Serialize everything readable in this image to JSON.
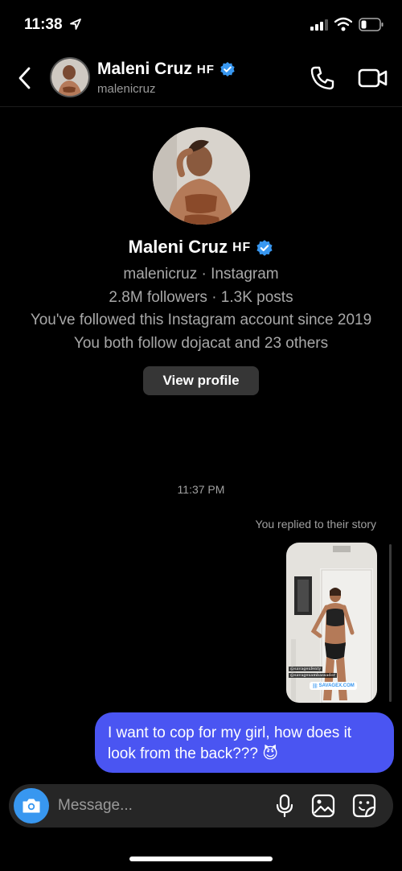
{
  "status_bar": {
    "time": "11:38"
  },
  "header": {
    "name": "Maleni Cruz",
    "name_tag": "HF",
    "username": "malenicruz"
  },
  "profile": {
    "name": "Maleni Cruz",
    "name_tag": "HF",
    "line1": "malenicruz · Instagram",
    "line2": "2.8M followers · 1.3K posts",
    "line3": "You've followed this Instagram account since 2019",
    "line4": "You both follow dojacat and 23 others",
    "view_profile_label": "View profile"
  },
  "thread": {
    "timestamp": "11:37 PM",
    "replied_note": "You replied to their story",
    "story_caption_1": "@savagexfenty",
    "story_caption_2": "@savagexambassador",
    "story_link": "SAVAGEX.COM",
    "message_text": "I want to cop for my girl, how does it look from the back??? 😈"
  },
  "composer": {
    "placeholder": "Message..."
  },
  "colors": {
    "bubble": "#4a55f2",
    "verified": "#3897f0",
    "camera_button": "#3897f0"
  }
}
